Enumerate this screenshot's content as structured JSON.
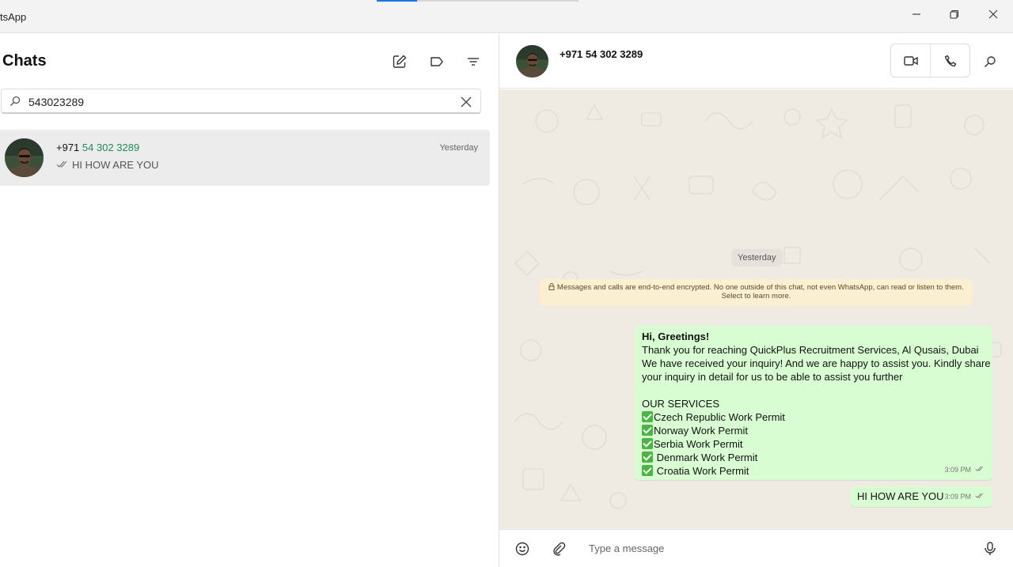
{
  "window": {
    "app_title": "tsApp",
    "loading_progress": 0.2
  },
  "sidebar": {
    "title": "Chats",
    "icons": [
      "new-chat-icon",
      "label-icon",
      "filter-icon"
    ],
    "search": {
      "value": "543023289",
      "placeholder": ""
    },
    "results": [
      {
        "name_prefix": "+971 ",
        "name_match": "54 302 3289",
        "time": "Yesterday",
        "preview": "HI HOW ARE YOU",
        "status": "read-double-tick"
      }
    ]
  },
  "conversation": {
    "contact_name": "+971 54 302 3289",
    "date_chip": "Yesterday",
    "encryption_line1": "Messages and calls are end-to-end encrypted. No one outside of this chat, not even WhatsApp, can read or listen to them.",
    "encryption_line2": "Select to learn more.",
    "messages": [
      {
        "greeting": "Hi, Greetings!",
        "lines": [
          "Thank you for reaching QuickPlus Recruitment Services, Al Qusais, Dubai",
          "We have received your inquiry! And we are happy to assist you. Kindly share",
          "your inquiry in detail for us to be able to assist you further"
        ],
        "services_heading": "OUR SERVICES",
        "services": [
          "Czech Republic Work Permit",
          "Norway Work Permit",
          "Serbia Work Permit",
          " Denmark Work Permit",
          " Croatia Work Permit"
        ],
        "time": "3:09 PM"
      },
      {
        "text": "HI HOW ARE YOU",
        "time": "3:09 PM"
      }
    ]
  },
  "composer": {
    "placeholder": "Type a message"
  },
  "colors": {
    "accent_green": "#1f8c5c",
    "outgoing_bubble": "#d9fdd3",
    "chat_background": "#efeae2",
    "encryption_note": "#fbefd2",
    "progress_blue": "#1a73e8"
  }
}
